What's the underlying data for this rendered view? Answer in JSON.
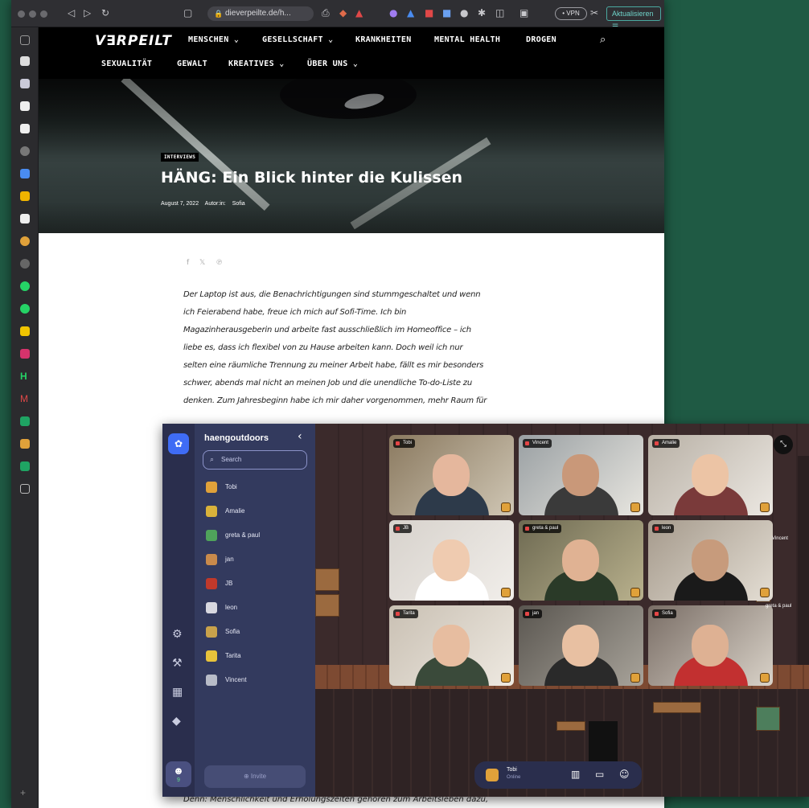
{
  "browser": {
    "url": "dieverpeilte.de/h...",
    "vpn_label": "• VPN",
    "update_label": "Aktualisieren ☰"
  },
  "site": {
    "logo": "V∃RPEILT",
    "nav_row1": [
      "MENSCHEN ⌄",
      "GESELLSCHAFT ⌄",
      "KRANKHEITEN",
      "MENTAL HEALTH",
      "DROGEN"
    ],
    "nav_row2": [
      "SEXUALITÄT",
      "GEWALT",
      "KREATIVES ⌄",
      "ÜBER UNS ⌄"
    ]
  },
  "article": {
    "category": "INTERVIEWS",
    "title": "HÄNG: Ein Blick hinter die Kulissen",
    "date": "August 7, 2022",
    "author_label": "Autor:in:",
    "author": "Sofia",
    "share_icons": [
      "f",
      "𝕏",
      "℗"
    ],
    "body_lines": [
      "Der Laptop ist aus, die Benachrichtigungen sind stummgeschaltet und wenn",
      "ich Feierabend habe, freue ich mich auf Sofi-Time. Ich bin",
      "Magazinherausgeberin und arbeite fast ausschließlich im Homeoffice – ich",
      "liebe es, dass ich flexibel von zu Hause arbeiten kann. Doch weil ich nur",
      "selten eine räumliche Trennung zu meiner Arbeit habe, fällt es mir besonders",
      "schwer, abends mal nicht an meinen Job und die unendliche To-do-Liste zu",
      "denken. Zum Jahresbeginn habe ich mir daher vorgenommen, mehr Raum für"
    ],
    "footer_line": "Denn: Menschlichkeit und Erholungszeiten gehören zum Arbeitsleben dazu,"
  },
  "gather": {
    "space_name": "haengoutdoors",
    "search_placeholder": "Search",
    "members": [
      {
        "name": "Tobi",
        "color": "#e0a13a"
      },
      {
        "name": "Amalie",
        "color": "#d9b23b"
      },
      {
        "name": "greta & paul",
        "color": "#4fa35b"
      },
      {
        "name": "jan",
        "color": "#c98a4b"
      },
      {
        "name": "JB",
        "color": "#c0392b"
      },
      {
        "name": "leon",
        "color": "#d8d8e0"
      },
      {
        "name": "Sofia",
        "color": "#c9a24b"
      },
      {
        "name": "Tarita",
        "color": "#e8c33b"
      },
      {
        "name": "Vincent",
        "color": "#b8bcc8"
      }
    ],
    "online_count": "9",
    "invite_label": "Invite",
    "videos": [
      "Tobi",
      "Vincent",
      "Amalie",
      "JB",
      "greta & paul",
      "leon",
      "Tarita",
      "jan",
      "Sofia"
    ],
    "map_labels": [
      "Vincent",
      "greta & paul"
    ],
    "self_name": "Tobi",
    "self_status": "Online"
  }
}
